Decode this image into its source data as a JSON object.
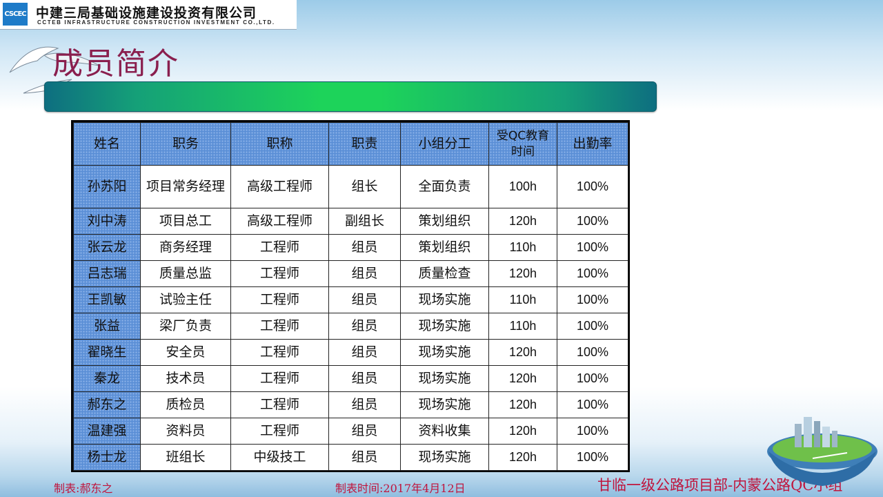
{
  "header": {
    "logo_text": "CSCEC",
    "company_cn": "中建三局基础设施建设投资有限公司",
    "company_en": "CCTEB INFRASTRUCTURE CONSTRUCTION INVESTMENT CO.,LTD."
  },
  "page_title": "成员简介",
  "table": {
    "headers": [
      "姓名",
      "职务",
      "职称",
      "职责",
      "小组分工",
      "受QC教育时间",
      "出勤率"
    ],
    "rows": [
      [
        "孙苏阳",
        "项目常务经理",
        "高级工程师",
        "组长",
        "全面负责",
        "100h",
        "100%"
      ],
      [
        "刘中涛",
        "项目总工",
        "高级工程师",
        "副组长",
        "策划组织",
        "120h",
        "100%"
      ],
      [
        "张云龙",
        "商务经理",
        "工程师",
        "组员",
        "策划组织",
        "110h",
        "100%"
      ],
      [
        "吕志瑞",
        "质量总监",
        "工程师",
        "组员",
        "质量检查",
        "120h",
        "100%"
      ],
      [
        "王凯敏",
        "试验主任",
        "工程师",
        "组员",
        "现场实施",
        "110h",
        "100%"
      ],
      [
        "张益",
        "梁厂负责",
        "工程师",
        "组员",
        "现场实施",
        "110h",
        "100%"
      ],
      [
        "翟晓生",
        "安全员",
        "工程师",
        "组员",
        "现场实施",
        "120h",
        "100%"
      ],
      [
        "秦龙",
        "技术员",
        "工程师",
        "组员",
        "现场实施",
        "120h",
        "100%"
      ],
      [
        "郝东之",
        "质检员",
        "工程师",
        "组员",
        "现场实施",
        "120h",
        "100%"
      ],
      [
        "温建强",
        "资料员",
        "工程师",
        "组员",
        "资料收集",
        "120h",
        "100%"
      ],
      [
        "杨士龙",
        "班组长",
        "中级技工",
        "组员",
        "现场实施",
        "120h",
        "100%"
      ]
    ]
  },
  "footer": {
    "maker": "制表:郝东之",
    "date": "制表时间:2017年4月12日",
    "org": "甘临一级公路项目部-内蒙公路QC小组"
  },
  "colors": {
    "title": "#8a1f4e",
    "footer_text": "#c0143c",
    "header_cell": "#5b8fd6",
    "band_center": "#1dd35a"
  }
}
